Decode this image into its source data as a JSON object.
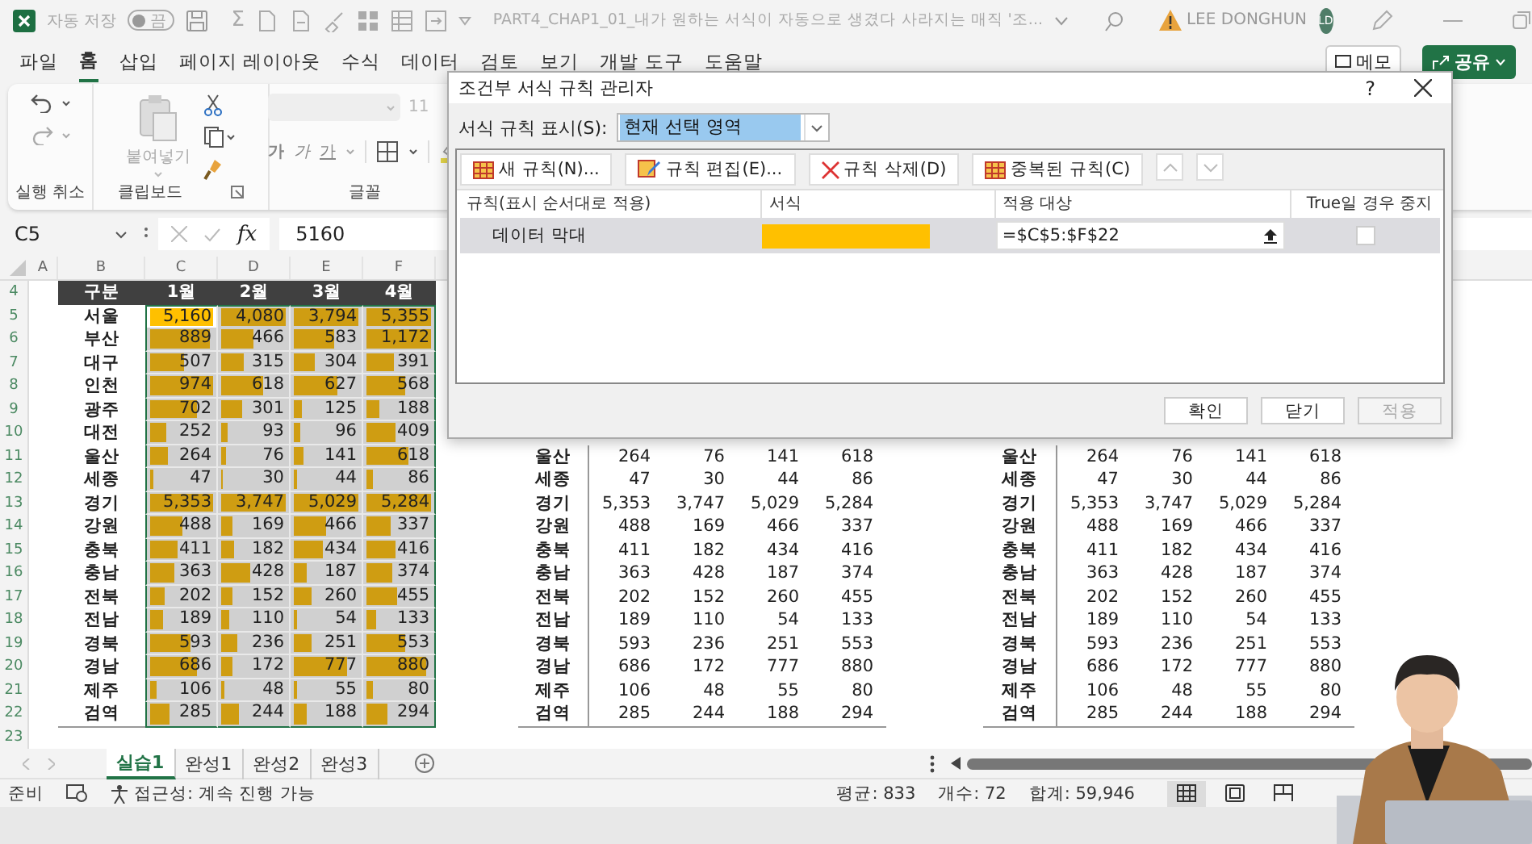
{
  "title_bar": {
    "autosave_label": "자동 저장",
    "autosave_toggle": {
      "label": "끔",
      "on": false
    },
    "sum_symbol": "Σ",
    "file_title": "PART4_CHAP1_01_내가 원하는 서식이 자동으로 생겼다 사라지는 매직 '조...",
    "user_name": "LEE DONGHUN",
    "avatar": "LD"
  },
  "menu_tabs": [
    {
      "label": "파일",
      "selected": false
    },
    {
      "label": "홈",
      "selected": true
    },
    {
      "label": "삽입",
      "selected": false
    },
    {
      "label": "페이지 레이아웃",
      "selected": false
    },
    {
      "label": "수식",
      "selected": false
    },
    {
      "label": "데이터",
      "selected": false
    },
    {
      "label": "검토",
      "selected": false
    },
    {
      "label": "보기",
      "selected": false
    },
    {
      "label": "개발 도구",
      "selected": false
    },
    {
      "label": "도움말",
      "selected": false
    }
  ],
  "memo_button": "메모",
  "share_button": "공유",
  "ribbon": {
    "paste_label": "붙여넣기",
    "font_size": "11",
    "font_buttons": [
      {
        "label": "가",
        "kind": "bold"
      },
      {
        "label": "가",
        "kind": "italic"
      },
      {
        "label": "가",
        "kind": "underline"
      }
    ],
    "groups": [
      "실행 취소",
      "클립보드",
      "글꼴"
    ]
  },
  "formula_bar": {
    "name_box": "C5",
    "fx": "fx",
    "value": "5160"
  },
  "sheet": {
    "columns": [
      "A",
      "B",
      "C",
      "D",
      "E",
      "F"
    ],
    "row_numbers": [
      "4",
      "5",
      "6",
      "7",
      "8",
      "9",
      "10",
      "11",
      "12",
      "13",
      "14",
      "15",
      "16",
      "17",
      "18",
      "19",
      "20",
      "21",
      "22",
      "23"
    ],
    "table_1": {
      "header": [
        "구분",
        "1월",
        "2월",
        "3월",
        "4월"
      ],
      "rows": [
        {
          "label": "서울",
          "cells": [
            {
              "v": "5,160",
              "level": 1,
              "selected": true
            },
            {
              "v": "4,080",
              "level": 1,
              "selected": false
            },
            {
              "v": "3,794",
              "level": 1,
              "selected": false
            },
            {
              "v": "5,355",
              "level": 1,
              "selected": false
            }
          ]
        },
        {
          "label": "부산",
          "cells": [
            {
              "v": "889",
              "level": 0.86,
              "selected": false
            },
            {
              "v": "466",
              "level": 0.45,
              "selected": false
            },
            {
              "v": "583",
              "level": 0.57,
              "selected": false
            },
            {
              "v": "1,172",
              "level": 1,
              "selected": false
            }
          ]
        },
        {
          "label": "대구",
          "cells": [
            {
              "v": "507",
              "level": 0.49,
              "selected": false
            },
            {
              "v": "315",
              "level": 0.31,
              "selected": false
            },
            {
              "v": "304",
              "level": 0.3,
              "selected": false
            },
            {
              "v": "391",
              "level": 0.38,
              "selected": false
            }
          ]
        },
        {
          "label": "인천",
          "cells": [
            {
              "v": "974",
              "level": 0.95,
              "selected": false
            },
            {
              "v": "618",
              "level": 0.6,
              "selected": false
            },
            {
              "v": "627",
              "level": 0.61,
              "selected": false
            },
            {
              "v": "568",
              "level": 0.55,
              "selected": false
            }
          ]
        },
        {
          "label": "광주",
          "cells": [
            {
              "v": "702",
              "level": 0.68,
              "selected": false
            },
            {
              "v": "301",
              "level": 0.29,
              "selected": false
            },
            {
              "v": "125",
              "level": 0.12,
              "selected": false
            },
            {
              "v": "188",
              "level": 0.18,
              "selected": false
            }
          ]
        },
        {
          "label": "대전",
          "cells": [
            {
              "v": "252",
              "level": 0.24,
              "selected": false
            },
            {
              "v": "93",
              "level": 0.09,
              "selected": false
            },
            {
              "v": "96",
              "level": 0.09,
              "selected": false
            },
            {
              "v": "409",
              "level": 0.4,
              "selected": false
            }
          ]
        },
        {
          "label": "울산",
          "cells": [
            {
              "v": "264",
              "level": 0.26,
              "selected": false
            },
            {
              "v": "76",
              "level": 0.07,
              "selected": false
            },
            {
              "v": "141",
              "level": 0.14,
              "selected": false
            },
            {
              "v": "618",
              "level": 0.6,
              "selected": false
            }
          ]
        },
        {
          "label": "세종",
          "cells": [
            {
              "v": "47",
              "level": 0.05,
              "selected": false
            },
            {
              "v": "30",
              "level": 0.03,
              "selected": false
            },
            {
              "v": "44",
              "level": 0.04,
              "selected": false
            },
            {
              "v": "86",
              "level": 0.08,
              "selected": false
            }
          ]
        },
        {
          "label": "경기",
          "cells": [
            {
              "v": "5,353",
              "level": 1,
              "selected": false
            },
            {
              "v": "3,747",
              "level": 1,
              "selected": false
            },
            {
              "v": "5,029",
              "level": 1,
              "selected": false
            },
            {
              "v": "5,284",
              "level": 1,
              "selected": false
            }
          ]
        },
        {
          "label": "강원",
          "cells": [
            {
              "v": "488",
              "level": 0.47,
              "selected": false
            },
            {
              "v": "169",
              "level": 0.16,
              "selected": false
            },
            {
              "v": "466",
              "level": 0.45,
              "selected": false
            },
            {
              "v": "337",
              "level": 0.33,
              "selected": false
            }
          ]
        },
        {
          "label": "충북",
          "cells": [
            {
              "v": "411",
              "level": 0.4,
              "selected": false
            },
            {
              "v": "182",
              "level": 0.18,
              "selected": false
            },
            {
              "v": "434",
              "level": 0.42,
              "selected": false
            },
            {
              "v": "416",
              "level": 0.4,
              "selected": false
            }
          ]
        },
        {
          "label": "충남",
          "cells": [
            {
              "v": "363",
              "level": 0.35,
              "selected": false
            },
            {
              "v": "428",
              "level": 0.42,
              "selected": false
            },
            {
              "v": "187",
              "level": 0.18,
              "selected": false
            },
            {
              "v": "374",
              "level": 0.36,
              "selected": false
            }
          ]
        },
        {
          "label": "전북",
          "cells": [
            {
              "v": "202",
              "level": 0.2,
              "selected": false
            },
            {
              "v": "152",
              "level": 0.15,
              "selected": false
            },
            {
              "v": "260",
              "level": 0.25,
              "selected": false
            },
            {
              "v": "455",
              "level": 0.44,
              "selected": false
            }
          ]
        },
        {
          "label": "전남",
          "cells": [
            {
              "v": "189",
              "level": 0.18,
              "selected": false
            },
            {
              "v": "110",
              "level": 0.11,
              "selected": false
            },
            {
              "v": "54",
              "level": 0.05,
              "selected": false
            },
            {
              "v": "133",
              "level": 0.13,
              "selected": false
            }
          ]
        },
        {
          "label": "경북",
          "cells": [
            {
              "v": "593",
              "level": 0.58,
              "selected": false
            },
            {
              "v": "236",
              "level": 0.23,
              "selected": false
            },
            {
              "v": "251",
              "level": 0.24,
              "selected": false
            },
            {
              "v": "553",
              "level": 0.54,
              "selected": false
            }
          ]
        },
        {
          "label": "경남",
          "cells": [
            {
              "v": "686",
              "level": 0.67,
              "selected": false
            },
            {
              "v": "172",
              "level": 0.17,
              "selected": false
            },
            {
              "v": "777",
              "level": 0.75,
              "selected": false
            },
            {
              "v": "880",
              "level": 0.85,
              "selected": false
            }
          ]
        },
        {
          "label": "제주",
          "cells": [
            {
              "v": "106",
              "level": 0.1,
              "selected": false
            },
            {
              "v": "48",
              "level": 0.05,
              "selected": false
            },
            {
              "v": "55",
              "level": 0.05,
              "selected": false
            },
            {
              "v": "80",
              "level": 0.08,
              "selected": false
            }
          ]
        },
        {
          "label": "검역",
          "cells": [
            {
              "v": "285",
              "level": 0.28,
              "selected": false
            },
            {
              "v": "244",
              "level": 0.24,
              "selected": false
            },
            {
              "v": "188",
              "level": 0.18,
              "selected": false
            },
            {
              "v": "294",
              "level": 0.29,
              "selected": false
            }
          ]
        }
      ]
    },
    "table_2": {
      "rows": [
        {
          "label": "울산",
          "values": [
            "264",
            "76",
            "141",
            "618"
          ]
        },
        {
          "label": "세종",
          "values": [
            "47",
            "30",
            "44",
            "86"
          ]
        },
        {
          "label": "경기",
          "values": [
            "5,353",
            "3,747",
            "5,029",
            "5,284"
          ]
        },
        {
          "label": "강원",
          "values": [
            "488",
            "169",
            "466",
            "337"
          ]
        },
        {
          "label": "충북",
          "values": [
            "411",
            "182",
            "434",
            "416"
          ]
        },
        {
          "label": "충남",
          "values": [
            "363",
            "428",
            "187",
            "374"
          ]
        },
        {
          "label": "전북",
          "values": [
            "202",
            "152",
            "260",
            "455"
          ]
        },
        {
          "label": "전남",
          "values": [
            "189",
            "110",
            "54",
            "133"
          ]
        },
        {
          "label": "경북",
          "values": [
            "593",
            "236",
            "251",
            "553"
          ]
        },
        {
          "label": "경남",
          "values": [
            "686",
            "172",
            "777",
            "880"
          ]
        },
        {
          "label": "제주",
          "values": [
            "106",
            "48",
            "55",
            "80"
          ]
        },
        {
          "label": "검역",
          "values": [
            "285",
            "244",
            "188",
            "294"
          ]
        }
      ]
    },
    "table_3": {
      "rows": [
        {
          "label": "울산",
          "values": [
            "264",
            "76",
            "141",
            "618"
          ]
        },
        {
          "label": "세종",
          "values": [
            "47",
            "30",
            "44",
            "86"
          ]
        },
        {
          "label": "경기",
          "values": [
            "5,353",
            "3,747",
            "5,029",
            "5,284"
          ]
        },
        {
          "label": "강원",
          "values": [
            "488",
            "169",
            "466",
            "337"
          ]
        },
        {
          "label": "충북",
          "values": [
            "411",
            "182",
            "434",
            "416"
          ]
        },
        {
          "label": "충남",
          "values": [
            "363",
            "428",
            "187",
            "374"
          ]
        },
        {
          "label": "전북",
          "values": [
            "202",
            "152",
            "260",
            "455"
          ]
        },
        {
          "label": "전남",
          "values": [
            "189",
            "110",
            "54",
            "133"
          ]
        },
        {
          "label": "경북",
          "values": [
            "593",
            "236",
            "251",
            "553"
          ]
        },
        {
          "label": "경남",
          "values": [
            "686",
            "172",
            "777",
            "880"
          ]
        },
        {
          "label": "제주",
          "values": [
            "106",
            "48",
            "55",
            "80"
          ]
        },
        {
          "label": "검역",
          "values": [
            "285",
            "244",
            "188",
            "294"
          ]
        }
      ]
    }
  },
  "sheet_tabs": [
    {
      "label": "실습1",
      "selected": true
    },
    {
      "label": "완성1",
      "selected": false
    },
    {
      "label": "완성2",
      "selected": false
    },
    {
      "label": "완성3",
      "selected": false
    }
  ],
  "status_bar": {
    "ready": "준비",
    "accessibility": "접근성: 계속 진행 가능",
    "average": "평균: 833",
    "count": "개수: 72",
    "sum": "합계: 59,946",
    "views": [
      {
        "kind": "normal",
        "selected": true
      },
      {
        "kind": "page_layout",
        "selected": false
      },
      {
        "kind": "page_break",
        "selected": false
      }
    ]
  },
  "dialog": {
    "title": "조건부 서식 규칙 관리자",
    "help": "?",
    "show_label": "서식 규칙 표시(S):",
    "show_value": "현재 선택 영역",
    "toolbar": [
      {
        "label": "새 규칙(N)...",
        "kind": "new"
      },
      {
        "label": "규칙 편집(E)...",
        "kind": "edit"
      },
      {
        "label": "규칙 삭제(D)",
        "kind": "delete"
      },
      {
        "label": "중복된 규칙(C)",
        "kind": "duplicate"
      }
    ],
    "columns": [
      "규칙(표시 순서대로 적용)",
      "서식",
      "적용 대상",
      "True일 경우 중지"
    ],
    "rules": [
      {
        "name": "데이터 막대",
        "color": "#ffc000",
        "applies_to": "=$C$5:$F$22",
        "stop_if_true": false,
        "selected": true
      }
    ],
    "buttons": [
      {
        "label": "확인",
        "disabled": false
      },
      {
        "label": "닫기",
        "disabled": false
      },
      {
        "label": "적용",
        "disabled": true
      }
    ]
  }
}
